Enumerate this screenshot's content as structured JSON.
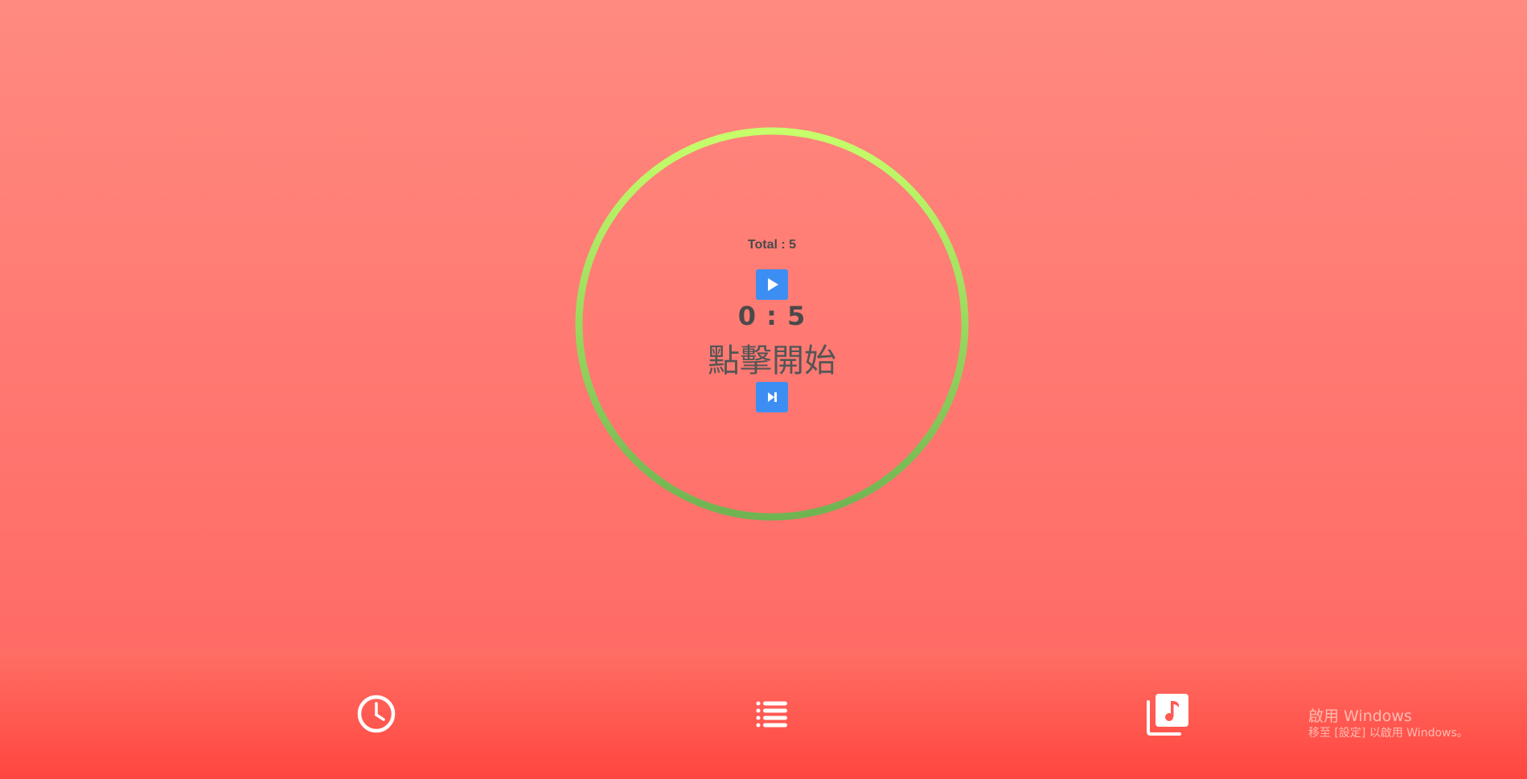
{
  "timer": {
    "total_label": "Total : 5",
    "time_display": "0 : 5",
    "status_text": "點擊開始",
    "play_icon": "play-icon",
    "skip_icon": "skip-next-icon"
  },
  "ring": {
    "color_top": "#c6ff6a",
    "color_bottom": "#6fb352"
  },
  "bottom_nav": {
    "items": [
      {
        "icon": "clock-icon"
      },
      {
        "icon": "list-icon"
      },
      {
        "icon": "music-library-icon"
      }
    ]
  },
  "watermark": {
    "title": "啟用 Windows",
    "subtitle": "移至 [設定] 以啟用 Windows。"
  },
  "colors": {
    "button_blue": "#3d8ef3",
    "text_dark": "#4a4a4a",
    "background_top": "#ff8a80",
    "background_bottom": "#ff4640"
  }
}
